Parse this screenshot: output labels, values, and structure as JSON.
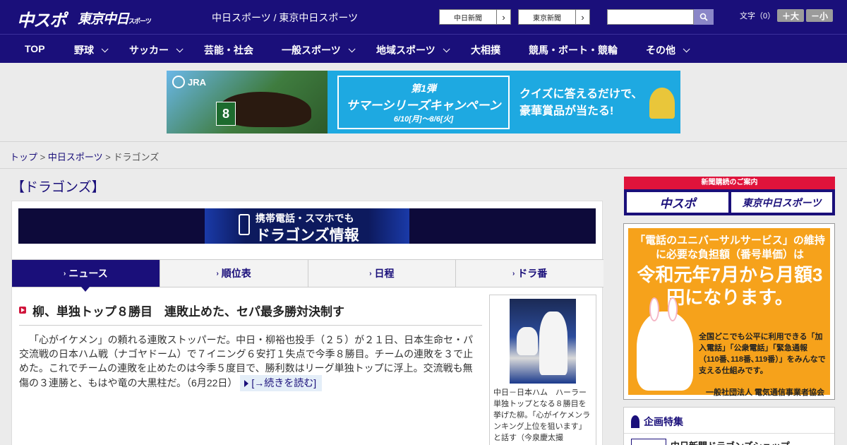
{
  "header": {
    "logo_main": "中スポ",
    "logo_sub": "東京中日",
    "logo_sub_small": "スポーツ",
    "site_title": "中日スポーツ / 東京中日スポーツ",
    "paper_links": [
      {
        "label": "中日新聞"
      },
      {
        "label": "東京新聞"
      }
    ],
    "search": {
      "value": "",
      "placeholder": ""
    },
    "font_size": {
      "label": "文字（0）",
      "increase": "＋大",
      "decrease": "－小"
    }
  },
  "nav": {
    "items": [
      {
        "label": "TOP",
        "has_dropdown": false
      },
      {
        "label": "野球",
        "has_dropdown": true
      },
      {
        "label": "サッカー",
        "has_dropdown": true
      },
      {
        "label": "芸能・社会",
        "has_dropdown": false
      },
      {
        "label": "一般スポーツ",
        "has_dropdown": true
      },
      {
        "label": "地域スポーツ",
        "has_dropdown": true
      },
      {
        "label": "大相撲",
        "has_dropdown": false
      },
      {
        "label": "競馬・ボート・競輪",
        "has_dropdown": false
      },
      {
        "label": "その他",
        "has_dropdown": true
      }
    ]
  },
  "ad_banner": {
    "brand": "JRA",
    "bib_number": "8",
    "campaign_line1": "第1弾",
    "campaign_line2": "サマーシリーズキャンペーン",
    "campaign_dates": "6/10[月]～8/6[火]",
    "quiz_line1": "クイズに答えるだけで、",
    "quiz_line2": "豪華賞品が当たる!"
  },
  "breadcrumb": {
    "items": [
      "トップ",
      "中日スポーツ"
    ],
    "current": "ドラゴンズ",
    "separator": ">"
  },
  "section_title": "【ドラゴンズ】",
  "dragons_banner": {
    "line1": "携帯電話・スマホでも",
    "line2": "ドラゴンズ情報"
  },
  "tabs": [
    {
      "label": "ニュース",
      "active": true
    },
    {
      "label": "順位表",
      "active": false
    },
    {
      "label": "日程",
      "active": false
    },
    {
      "label": "ドラ番",
      "active": false
    }
  ],
  "article": {
    "headline": "柳、単独トップ８勝目　連敗止めた、セパ最多勝対決制す",
    "body": "「心がイケメン」の頼れる連敗ストッパーだ。中日・柳裕也投手（２５）が２１日、日本生命セ・パ交流戦の日本ハム戦（ナゴヤドーム）で７イニング６安打１失点で今季８勝目。チームの連敗を３で止めた。これでチームの連敗を止めたのは今季５度目で、勝利数はリーグ単独トップに浮上。交流戦も無傷の３連勝と、もはや竜の大黒柱だ。",
    "date": "（6月22日）",
    "read_more": "[→続きを読む]",
    "photo_caption": "中日－日本ハム　ハーラー単独トップとなる８勝目を挙げた柳。「心がイケメンランキング上位を狙います」と話す（今泉慶太撮"
  },
  "sidebar": {
    "subscribe": {
      "header": "新聞購読のご案内",
      "links": [
        {
          "label": "中スポ"
        },
        {
          "label": "東京中日スポーツ"
        }
      ]
    },
    "ad": {
      "line1": "「電話のユニバーサルサービス」の維持に必要な負担額（番号単価）は",
      "line2": "令和元年7月から月額3円になります。",
      "line3": "全国どこでも公平に利用できる「加入電話」「公衆電話」「緊急通報（110番､118番､119番）」をみんなで支える仕組みです。",
      "sponsor": "一般社団法人 電気通信事業者協会"
    },
    "feature": {
      "title": "企画特集",
      "item": "中日新聞ドラゴンズショップ"
    }
  },
  "colors": {
    "brand_navy": "#1a0f7a",
    "accent_red": "#e0133b",
    "ad_orange": "#f6a21b"
  }
}
